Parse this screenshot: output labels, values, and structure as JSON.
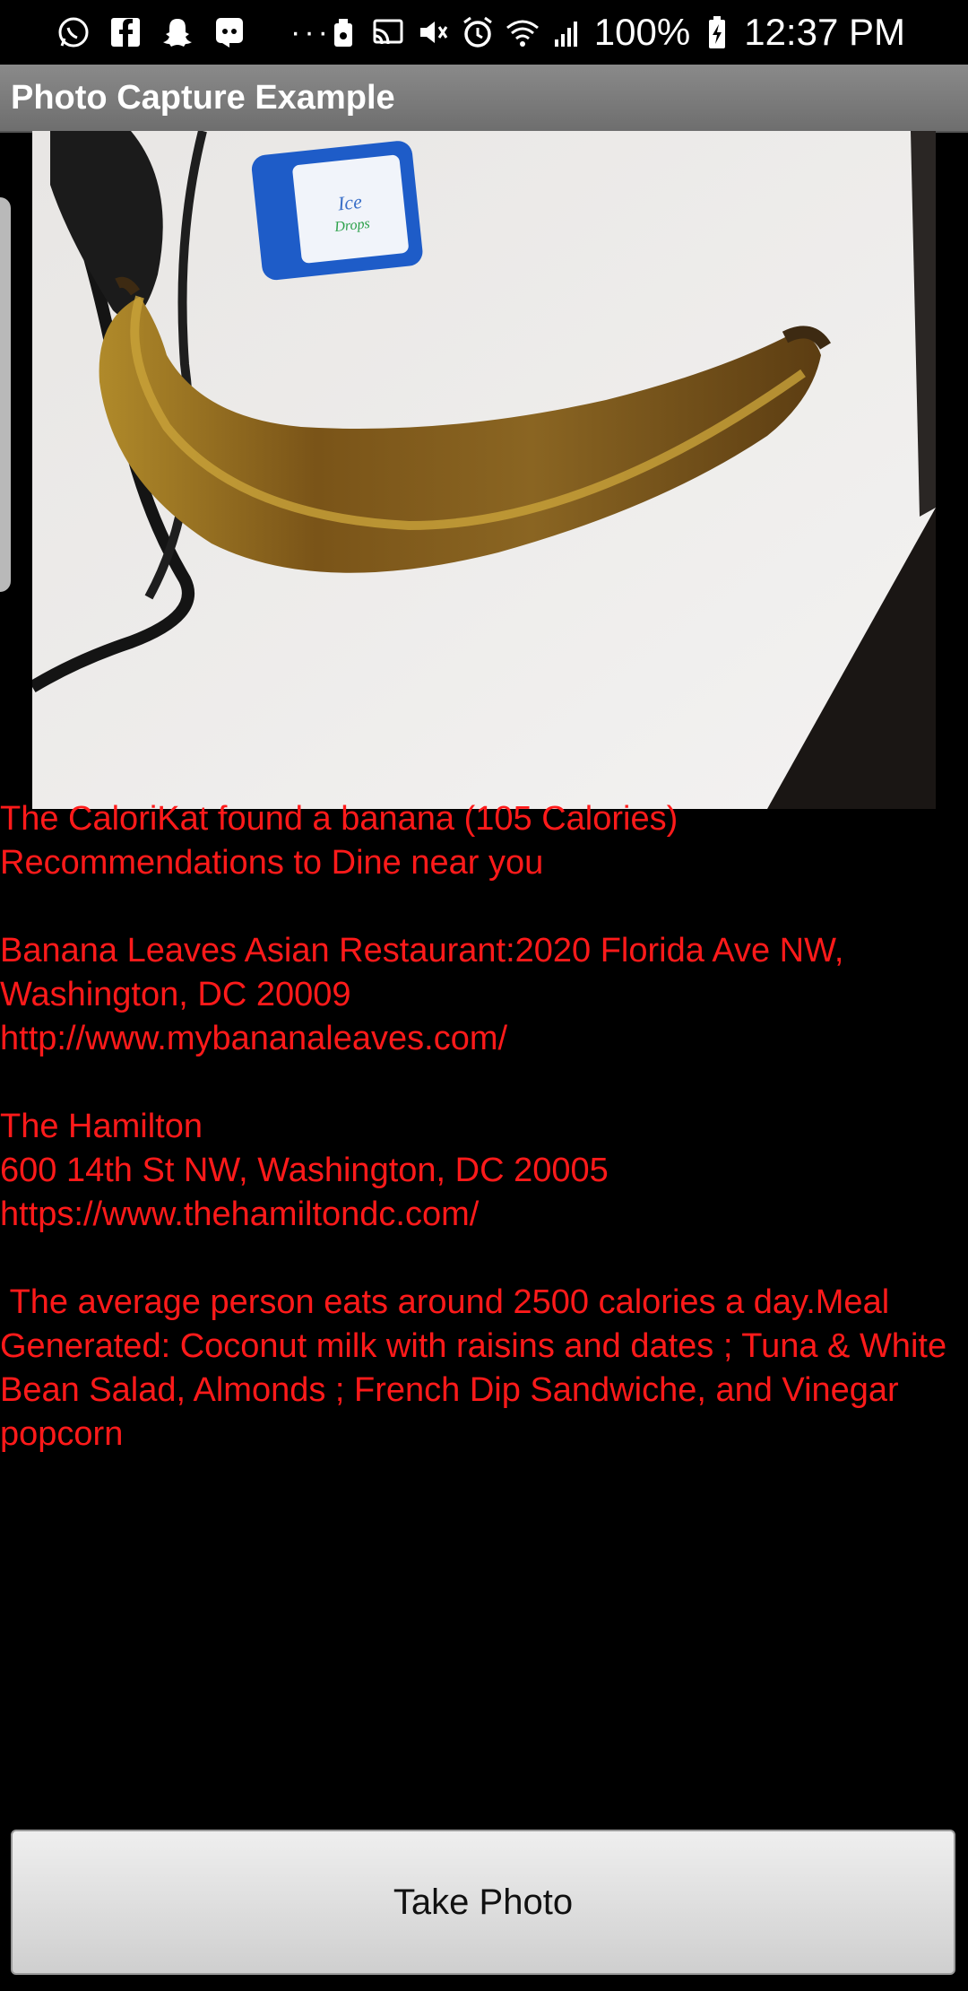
{
  "status_bar": {
    "icons_left": [
      "whatsapp-icon",
      "facebook-icon",
      "snapchat-icon",
      "discord-icon"
    ],
    "dots": "···",
    "icons_right": [
      "android-icon",
      "cast-icon",
      "mute-icon",
      "alarm-icon",
      "wifi-icon",
      "signal-icon"
    ],
    "battery": "100%",
    "time": "12:37 PM"
  },
  "action_bar": {
    "title": "Photo Capture Example"
  },
  "photo": {
    "label": "photo-preview"
  },
  "result": {
    "line1": "The CaloriKat found a banana (105 Calories)",
    "line2": "Recommendations to Dine near you",
    "restaurant1_line1": "Banana Leaves Asian Restaurant:2020 Florida Ave NW, Washington, DC 20009",
    "restaurant1_url": "http://www.mybananaleaves.com/",
    "restaurant2_name": "The Hamilton",
    "restaurant2_address": "600 14th St NW, Washington, DC 20005",
    "restaurant2_url": "https://www.thehamiltondc.com/",
    "meal_text": " The average person eats around 2500 calories a day.Meal Generated: Coconut milk with raisins and dates ; Tuna & White Bean Salad, Almonds ; French Dip Sandwiche, and Vinegar popcorn"
  },
  "button": {
    "label": "Take Photo"
  }
}
